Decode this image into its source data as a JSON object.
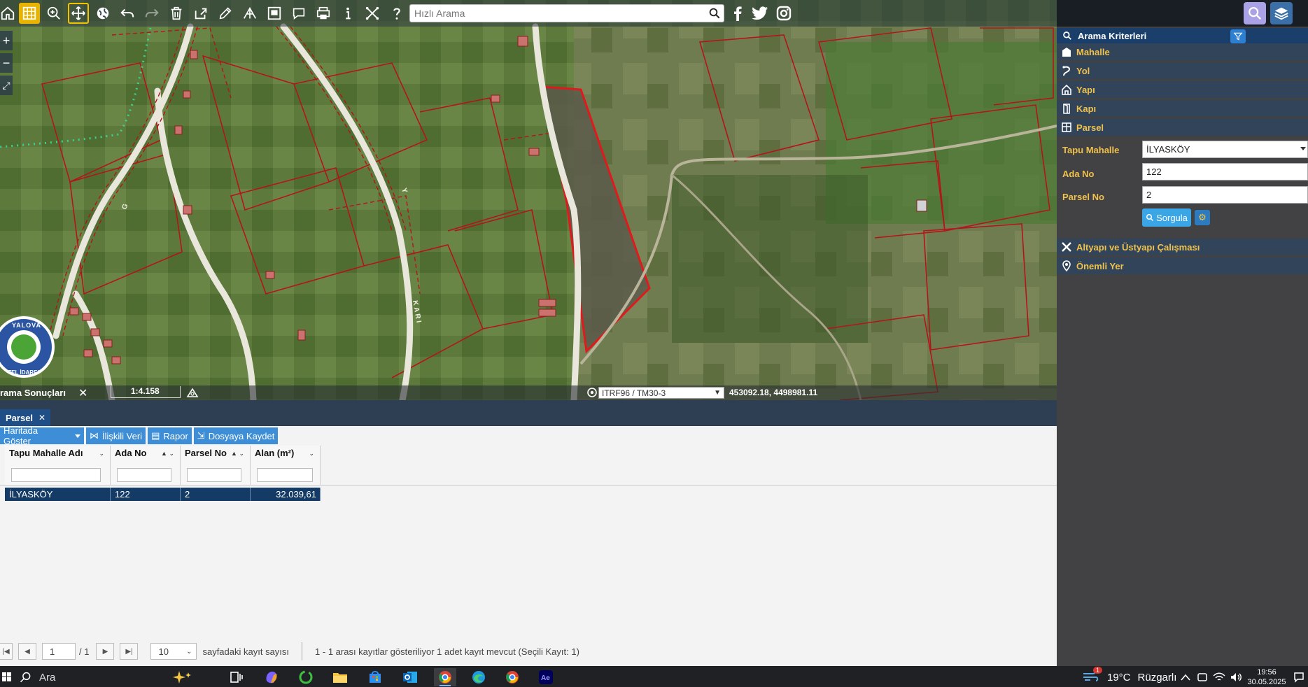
{
  "toolbar": {
    "search_placeholder": "Hızlı Arama",
    "icons": [
      "home-icon",
      "grid-select-icon",
      "zoom-in-icon",
      "pan-icon",
      "globe-icon",
      "undo-icon",
      "redo-icon",
      "trash-icon",
      "share-icon",
      "pencil-icon",
      "layers-tool-icon",
      "frame-icon",
      "comment-icon",
      "print-icon",
      "info-icon",
      "measure-icon",
      "help-icon"
    ],
    "social": [
      "facebook-icon",
      "twitter-icon",
      "instagram-icon"
    ]
  },
  "map": {
    "zoom_in": "+",
    "zoom_out": "−",
    "fullscreen": "⤢",
    "logo_top": "YALOVA",
    "logo_bottom": "ÖZEL İDARESİ",
    "results_label": "rama Sonuçları",
    "results_close": "✕",
    "scale": "1:4.158",
    "crs": "ITRF96 / TM30-3",
    "coordinates": "453092.18, 4498981.11"
  },
  "right_panel": {
    "header": "Arama Kriterleri",
    "items": [
      {
        "label": "Mahalle",
        "icon": "building-icon"
      },
      {
        "label": "Yol",
        "icon": "road-icon"
      },
      {
        "label": "Yapı",
        "icon": "house-icon"
      },
      {
        "label": "Kapı",
        "icon": "door-icon"
      },
      {
        "label": "Parsel",
        "icon": "parcel-icon"
      }
    ],
    "form": {
      "tapu_mahalle_label": "Tapu Mahalle",
      "tapu_mahalle_value": "İLYASKÖY",
      "ada_no_label": "Ada No",
      "ada_no_value": "122",
      "parsel_no_label": "Parsel No",
      "parsel_no_value": "2",
      "query_button": "Sorgula"
    },
    "extra_items": [
      {
        "label": "Altyapı ve Üstyapı Çalışması",
        "icon": "tools-icon"
      },
      {
        "label": "Önemli Yer",
        "icon": "pin-icon"
      }
    ]
  },
  "results": {
    "tab_label": "Parsel",
    "tab_close": "✕",
    "actions": {
      "show_on_map": "Haritada Göster",
      "related_data": "İlişkili Veri",
      "report": "Rapor",
      "save_file": "Dosyaya Kaydet"
    },
    "columns": [
      "Tapu Mahalle Adı",
      "Ada No",
      "Parsel No",
      "Alan (m²)"
    ],
    "rows": [
      {
        "mahalle": "İLYASKÖY",
        "ada": "122",
        "parsel": "2",
        "alan": "32.039,61"
      }
    ],
    "pager": {
      "page": "1",
      "of_pages": "/ 1",
      "page_size": "10",
      "page_size_label": "sayfadaki kayıt sayısı",
      "summary": "1 - 1 arası kayıtlar gösteriliyor 1 adet kayıt mevcut (Seçili Kayıt: 1)"
    }
  },
  "taskbar": {
    "search_label": "Ara",
    "temperature": "19°C",
    "weather": "Rüzgarlı",
    "time": "19:56",
    "date": "30.05.2025",
    "notification_count": "1"
  }
}
